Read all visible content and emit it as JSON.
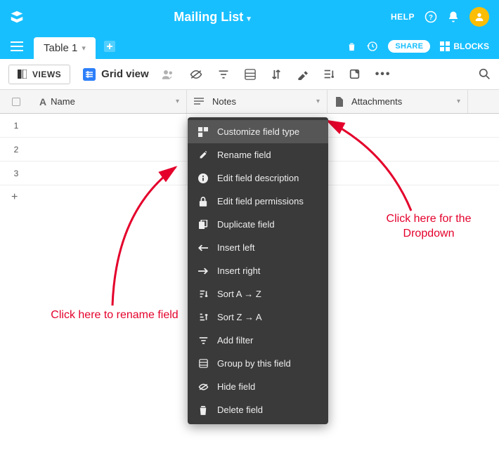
{
  "topbar": {
    "title": "Mailing List",
    "help_label": "HELP"
  },
  "tabs": {
    "active": "Table 1"
  },
  "tabbar": {
    "share_label": "SHARE",
    "blocks_label": "BLOCKS"
  },
  "toolbar": {
    "views_label": "VIEWS",
    "gridview_label": "Grid view"
  },
  "columns": {
    "name": "Name",
    "notes": "Notes",
    "attachments": "Attachments"
  },
  "rows": [
    "1",
    "2",
    "3"
  ],
  "dropdown": {
    "items": [
      {
        "icon": "customize",
        "label": "Customize field type"
      },
      {
        "icon": "pencil",
        "label": "Rename field"
      },
      {
        "icon": "info",
        "label": "Edit field description"
      },
      {
        "icon": "lock",
        "label": "Edit field permissions"
      },
      {
        "icon": "copy",
        "label": "Duplicate field"
      },
      {
        "icon": "arrow-left",
        "label": "Insert left"
      },
      {
        "icon": "arrow-right",
        "label": "Insert right"
      },
      {
        "icon": "sort-az",
        "label": "Sort A → Z"
      },
      {
        "icon": "sort-za",
        "label": "Sort Z → A"
      },
      {
        "icon": "filter",
        "label": "Add filter"
      },
      {
        "icon": "group",
        "label": "Group by this field"
      },
      {
        "icon": "hide",
        "label": "Hide field"
      },
      {
        "icon": "trash",
        "label": "Delete field"
      }
    ]
  },
  "annotations": {
    "rename": "Click here to rename field",
    "dropdown": "Click here for the Dropdown"
  }
}
